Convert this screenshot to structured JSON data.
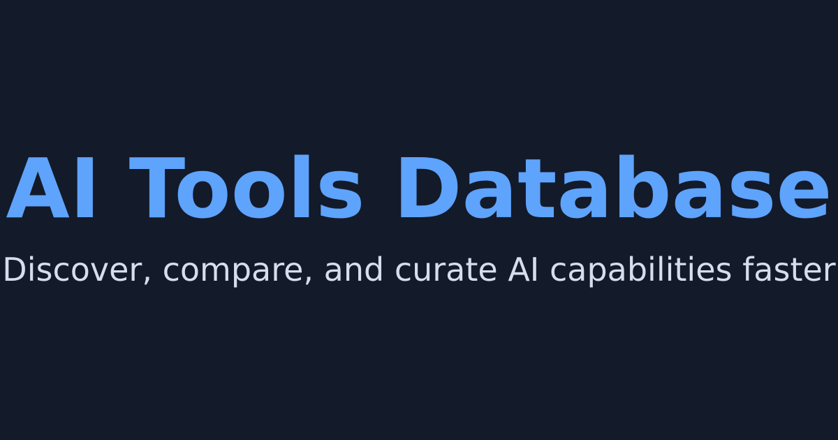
{
  "hero": {
    "title": "AI Tools Database",
    "subtitle": "Discover, compare, and curate AI capabilities faster"
  },
  "colors": {
    "background": "#131a29",
    "title": "#5ea3fc",
    "subtitle": "#d5deec"
  }
}
